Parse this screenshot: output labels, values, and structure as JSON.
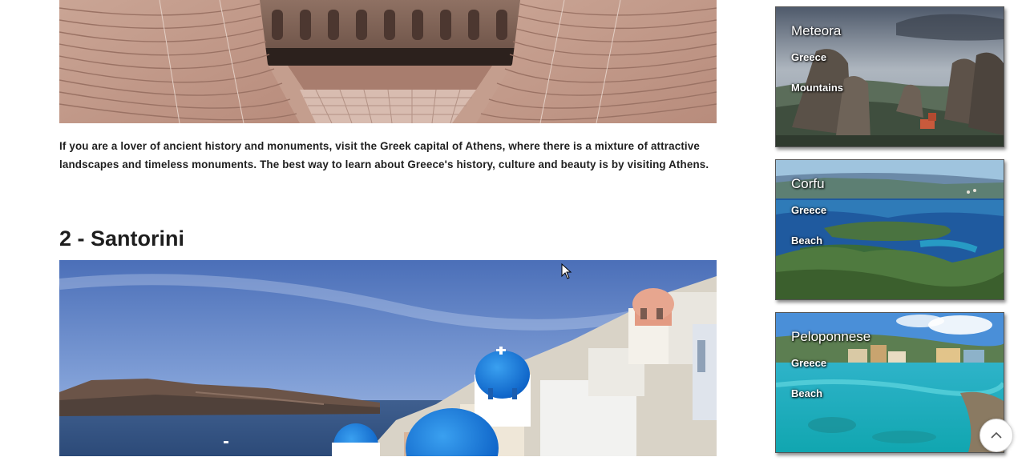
{
  "article": {
    "paragraph": "If you are a lover of ancient history and monuments, visit the Greek capital of Athens, where there is a mixture of attractive landscapes and timeless monuments. The best way to learn about Greece's history, culture and beauty is by visiting Athens.",
    "section_heading": "2 - Santorini"
  },
  "sidebar": {
    "cards": [
      {
        "title": "Meteora",
        "country": "Greece",
        "type": "Mountains"
      },
      {
        "title": "Corfu",
        "country": "Greece",
        "type": "Beach"
      },
      {
        "title": "Peloponnese",
        "country": "Greece",
        "type": "Beach"
      }
    ]
  },
  "icons": {
    "scroll_top": "chevron-up-icon",
    "cursor": "mouse-pointer-icon"
  },
  "colors": {
    "heading": "#1e1e1e",
    "body_text": "#1f1f1f",
    "card_text": "#ffffff"
  }
}
